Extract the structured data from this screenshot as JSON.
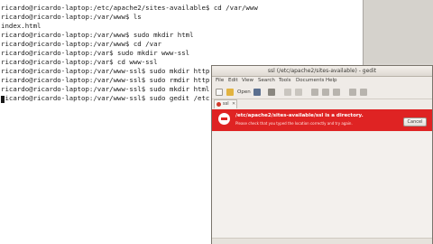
{
  "terminal": {
    "lines": [
      "ricardo@ricardo-laptop:/etc/apache2/sites-available$ cd /var/www",
      "ricardo@ricardo-laptop:/var/www$ ls",
      "index.html",
      "ricardo@ricardo-laptop:/var/www$ sudo mkdir html",
      "ricardo@ricardo-laptop:/var/www$ cd /var",
      "ricardo@ricardo-laptop:/var$ sudo mkdir www-ssl",
      "ricardo@ricardo-laptop:/var$ cd www-ssl",
      "ricardo@ricardo-laptop:/var/www-ssl$ sudo mkdir http",
      "ricardo@ricardo-laptop:/var/www-ssl$ sudo rmdir http",
      "ricardo@ricardo-laptop:/var/www-ssl$ sudo mkdir html",
      "ricardo@ricardo-laptop:/var/www-ssl$ sudo gedit /etc"
    ]
  },
  "gedit": {
    "title": "ssl (/etc/apache2/sites-available) - gedit",
    "menu": [
      "File",
      "Edit",
      "View",
      "Search",
      "Tools",
      "Documents",
      "Help"
    ],
    "toolbar": {
      "open_label": "Open",
      "icons": [
        "new-document-icon",
        "open-folder-icon",
        "save-icon",
        "print-icon",
        "undo-icon",
        "redo-icon",
        "cut-icon",
        "copy-icon",
        "paste-icon",
        "search-icon",
        "replace-icon"
      ]
    },
    "tab": {
      "label": "ssl",
      "close_glyph": "✕"
    },
    "error": {
      "title": "/etc/apache2/sites-available/ssl is a directory.",
      "detail": "Please check that you typed the location correctly and try again.",
      "cancel_label": "Cancel",
      "color": "#df2323"
    }
  }
}
